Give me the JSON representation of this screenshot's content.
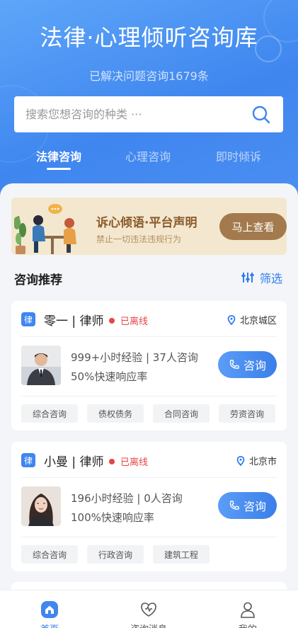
{
  "header": {
    "title": "法律·心理倾听咨询库",
    "subtitle": "已解决问题咨询1679条"
  },
  "search": {
    "placeholder": "搜索您想咨询的种类 ···"
  },
  "tabs": [
    {
      "label": "法律咨询",
      "active": true
    },
    {
      "label": "心理咨询",
      "active": false
    },
    {
      "label": "即时倾诉",
      "active": false
    }
  ],
  "banner": {
    "title": "诉心倾语·平台声明",
    "subtitle": "禁止一切违法违规行为",
    "button": "马上查看"
  },
  "recommend": {
    "title": "咨询推荐",
    "filter_label": "筛选"
  },
  "cards": [
    {
      "badge": "律",
      "name": "零一 | 律师",
      "status": "已离线",
      "location": "北京城区",
      "stat1": "999+小时经验 | 37人咨询",
      "stat2": "50%快速响应率",
      "button": "咨询",
      "tags": [
        "综合咨询",
        "债权债务",
        "合同咨询",
        "劳资咨询"
      ]
    },
    {
      "badge": "律",
      "name": "小曼 | 律师",
      "status": "已离线",
      "location": "北京市",
      "stat1": "196小时经验 | 0人咨询",
      "stat2": "100%快速响应率",
      "button": "咨询",
      "tags": [
        "综合咨询",
        "行政咨询",
        "建筑工程"
      ]
    }
  ],
  "tabbar": [
    {
      "label": "首页",
      "icon": "home-icon",
      "active": true
    },
    {
      "label": "咨询消息",
      "icon": "message-icon",
      "active": false
    },
    {
      "label": "我的",
      "icon": "user-icon",
      "active": false
    }
  ],
  "colors": {
    "primary": "#3f86ef",
    "banner_bg": "#f3e8cf",
    "banner_button": "#a37a4d",
    "offline": "#e64545"
  }
}
